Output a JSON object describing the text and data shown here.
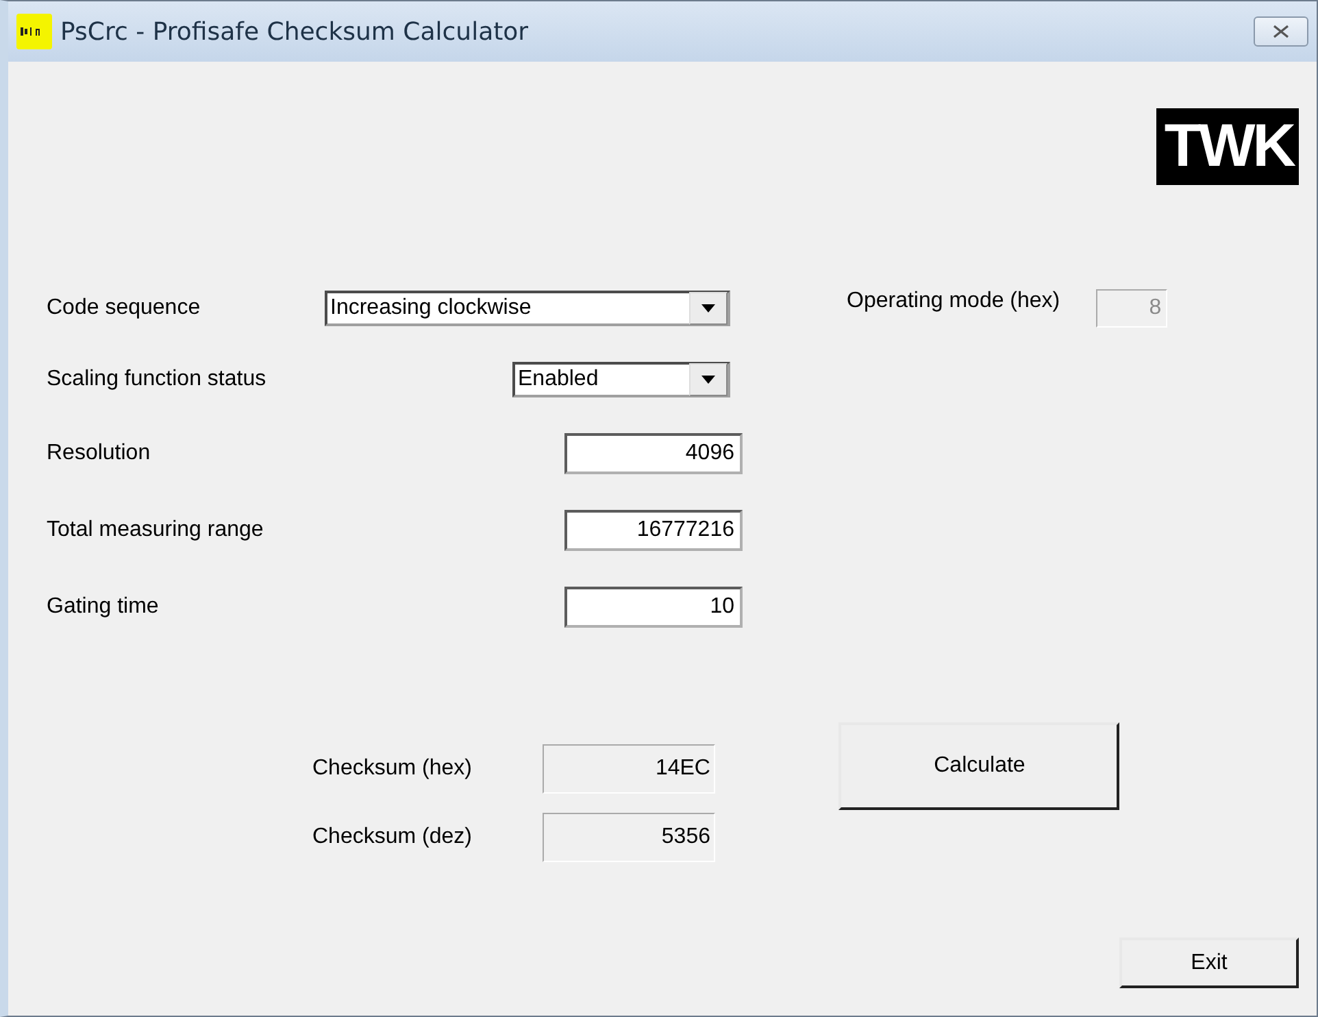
{
  "window": {
    "title": "PsCrc - Profisafe Checksum Calculator"
  },
  "logo": {
    "text": "TWK"
  },
  "fields": [
    {
      "kind": "combo",
      "label": "Code sequence",
      "value": "Increasing clockwise"
    },
    {
      "kind": "combo",
      "label": "Scaling function status",
      "value": "Enabled"
    },
    {
      "kind": "text",
      "label": "Resolution",
      "value": "4096"
    },
    {
      "kind": "text",
      "label": "Total measuring range",
      "value": "16777216"
    },
    {
      "kind": "text",
      "label": "Gating time",
      "value": "10"
    }
  ],
  "operating_mode": {
    "label": "Operating mode (hex)",
    "value": "8",
    "disabled": true
  },
  "checksums": [
    {
      "label": "Checksum (hex)",
      "value": "14EC",
      "disabled": false
    },
    {
      "label": "Checksum (dez)",
      "value": "5356",
      "disabled": false
    }
  ],
  "buttons": {
    "calculate": "Calculate",
    "exit": "Exit"
  }
}
